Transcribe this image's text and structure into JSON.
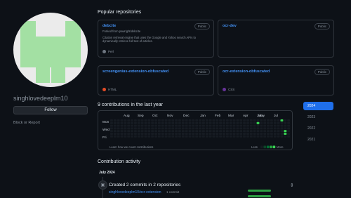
{
  "profile": {
    "username": "singhlovedeeplm10",
    "follow_label": "Follow",
    "block_label": "Block or Report",
    "avatar_color": "#a3e0a3"
  },
  "popular": {
    "title": "Popular repositories",
    "repos": [
      {
        "name": "debcite",
        "badge": "Public",
        "fork_prefix": "Forked from",
        "fork_source": "pawright/debcite",
        "description": "Citation retrieval engine that uses the Google and Yahoo search APIs to dynamically retrieve full text of articles.",
        "language": "Perl",
        "lang_color": "#6e7681"
      },
      {
        "name": "ocr-dev",
        "badge": "Public",
        "fork_prefix": "",
        "fork_source": "",
        "description": "",
        "language": "",
        "lang_color": ""
      },
      {
        "name": "screengenius-extension-obfuscated",
        "badge": "Public",
        "fork_prefix": "",
        "fork_source": "",
        "description": "",
        "language": "HTML",
        "lang_color": "#e34c26"
      },
      {
        "name": "ocr-extension-obfuscated",
        "badge": "Public",
        "fork_prefix": "",
        "fork_source": "",
        "description": "",
        "language": "CSS",
        "lang_color": "#663399"
      }
    ]
  },
  "contributions": {
    "title": "9 contributions in the last year",
    "months": [
      "Aug",
      "Sep",
      "Oct",
      "Nov",
      "Dec",
      "Jan",
      "Feb",
      "Mar",
      "Apr",
      "May",
      "Jun",
      "Jul"
    ],
    "days": [
      "Mon",
      "Wed",
      "Fri"
    ],
    "learn_label": "Learn how we count contributions",
    "less_label": "Less",
    "more_label": "More",
    "empty_color": "#161b22",
    "level_colors": [
      "#0e4429",
      "#006d32",
      "#26a641",
      "#39d353"
    ]
  },
  "years": [
    "2024",
    "2023",
    "2022",
    "2021"
  ],
  "activity": {
    "title": "Contribution activity",
    "month_label": "July 2024",
    "created_label": "Created 2 commits in 2 repositories",
    "repo": "singhlovedeeplm10/ocr-extension",
    "commit_count": "1 commit"
  }
}
